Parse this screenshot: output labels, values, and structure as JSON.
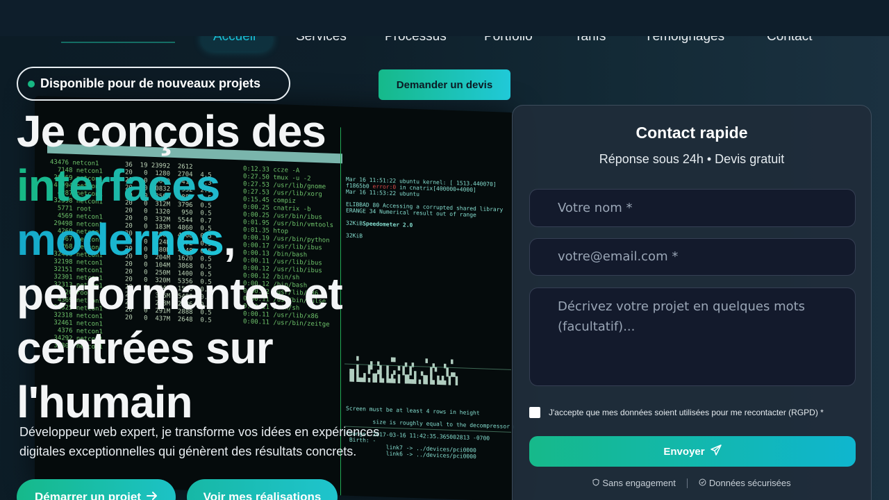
{
  "nav": {
    "items": [
      "Accueil",
      "Services",
      "Processus",
      "Portfolio",
      "Tarifs",
      "Témoignages",
      "Contact"
    ]
  },
  "badge": {
    "label": "Disponible pour de nouveaux projets"
  },
  "header": {
    "quote_button": "Demander un devis"
  },
  "hero": {
    "line1": "Je conçois des",
    "line2": "interfaces",
    "line3": "modernes",
    "line3_comma": ",",
    "line4": "performantes et",
    "line5": "centrées sur",
    "line6": "l'humain",
    "subtitle": "Développeur web expert, je transforme vos idées en expériences digitales exceptionnelles qui génèrent des résultats concrets.",
    "cta_primary": "Démarrer un projet",
    "cta_secondary": "Voir mes réalisations"
  },
  "contact": {
    "title": "Contact rapide",
    "subtitle": "Réponse sous 24h • Devis gratuit",
    "name_placeholder": "Votre nom *",
    "email_placeholder": "votre@email.com *",
    "message_placeholder": "Décrivez votre projet en quelques mots (facultatif)...",
    "consent": "J'accepte que mes données soient utilisées pour me recontacter (RGPD) *",
    "submit": "Envoyer",
    "note1": "Sans engagement",
    "note2": "Données sécurisées"
  },
  "icons": {
    "arrow": "arrow-right-icon",
    "send": "paper-plane-icon",
    "shield": "shield-icon",
    "lock": "lock-icon"
  },
  "colors": {
    "accent_green": "#17b883",
    "accent_cyan": "#20c9d8",
    "card_bg": "#202c3a",
    "page_bg": "#0b1a24"
  }
}
